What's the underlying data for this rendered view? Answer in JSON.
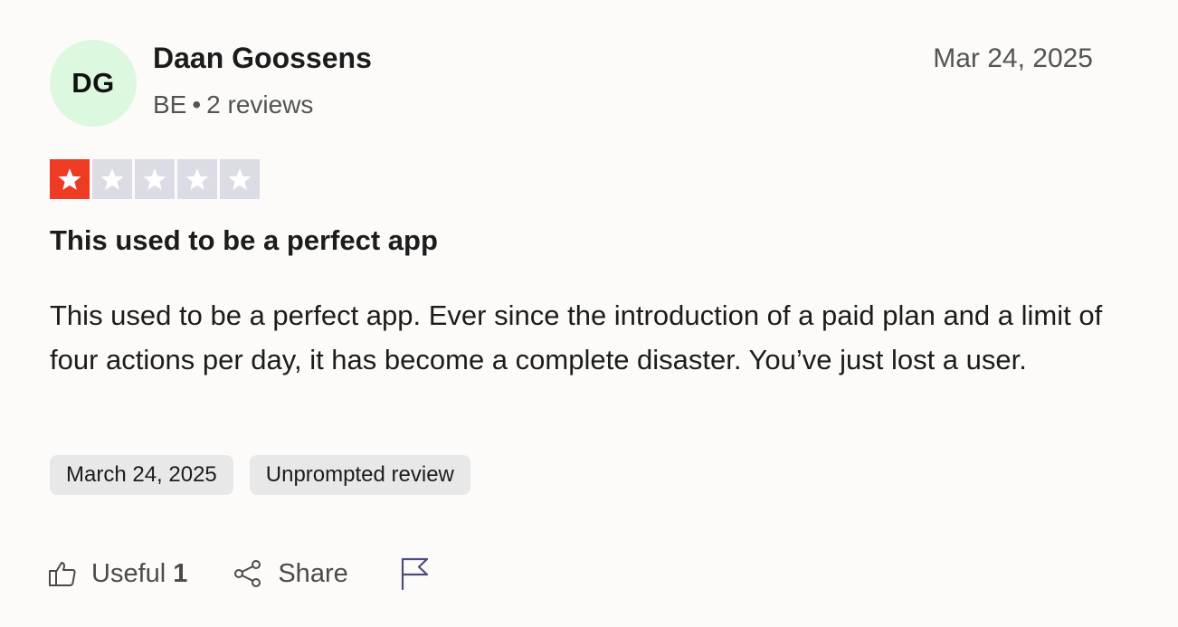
{
  "reviewer": {
    "initials": "DG",
    "name": "Daan Goossens",
    "country": "BE",
    "separator": "•",
    "review_count": "2 reviews",
    "avatar_color": "#dcf8de"
  },
  "review": {
    "date_short": "Mar 24, 2025",
    "rating": 1,
    "rating_max": 5,
    "title": "This used to be a perfect app",
    "body": "This used to be a perfect app. Ever since the introduction of a paid plan and a limit of four actions per day, it has become a complete disaster. You’ve just lost a user.",
    "tags": [
      {
        "label": "March 24, 2025"
      },
      {
        "label": "Unprompted review"
      }
    ]
  },
  "actions": {
    "useful_label": "Useful",
    "useful_count": "1",
    "share_label": "Share",
    "useful_icon": "thumbs-up-icon",
    "share_icon": "share-icon",
    "report_icon": "flag-icon"
  },
  "colors": {
    "star_filled": "#ee3b24",
    "star_empty": "#dcdce6",
    "flag": "#4d4c7d"
  }
}
